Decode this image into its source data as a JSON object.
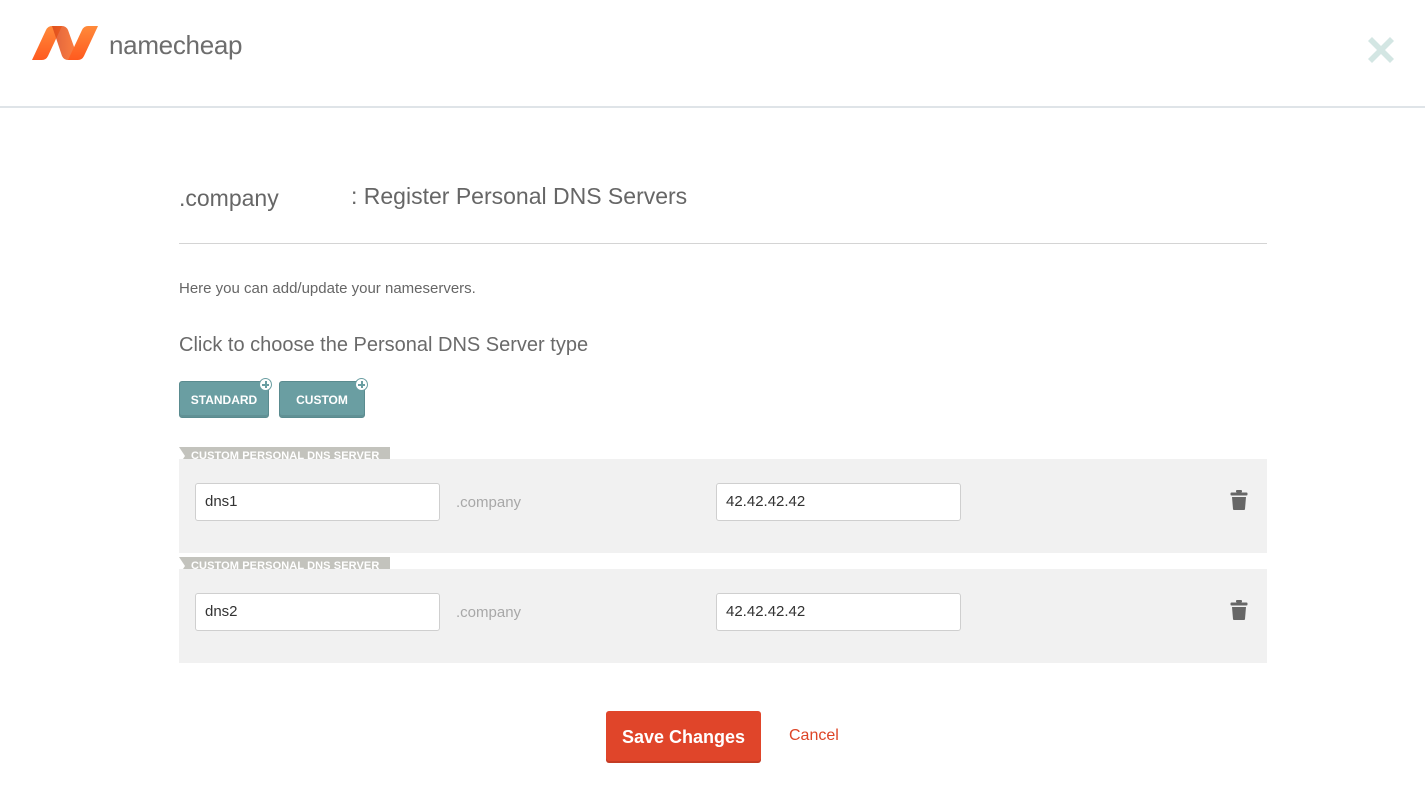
{
  "header": {
    "brand_name": "namecheap",
    "logo_icon": "namecheap-n-logo",
    "close_icon": "close-x-icon",
    "accent_color": "#ff6a1a",
    "close_color": "#d3e6e3"
  },
  "page": {
    "domain": ".company",
    "title": ": Register Personal DNS Servers",
    "intro": "Here you can add/update your nameservers.",
    "choose_label": "Click to choose the Personal DNS Server type"
  },
  "type_buttons": {
    "standard": "STANDARD",
    "custom": "CUSTOM",
    "color": "#6a9ea2"
  },
  "servers": [
    {
      "tag": "CUSTOM PERSONAL DNS SERVER",
      "host": "dns1",
      "suffix": ".company",
      "ip": "42.42.42.42",
      "delete_icon": "trash-icon"
    },
    {
      "tag": "CUSTOM PERSONAL DNS SERVER",
      "host": "dns2",
      "suffix": ".company",
      "ip": "42.42.42.42",
      "delete_icon": "trash-icon"
    }
  ],
  "actions": {
    "save": "Save Changes",
    "cancel": "Cancel",
    "save_color": "#e0452a"
  }
}
